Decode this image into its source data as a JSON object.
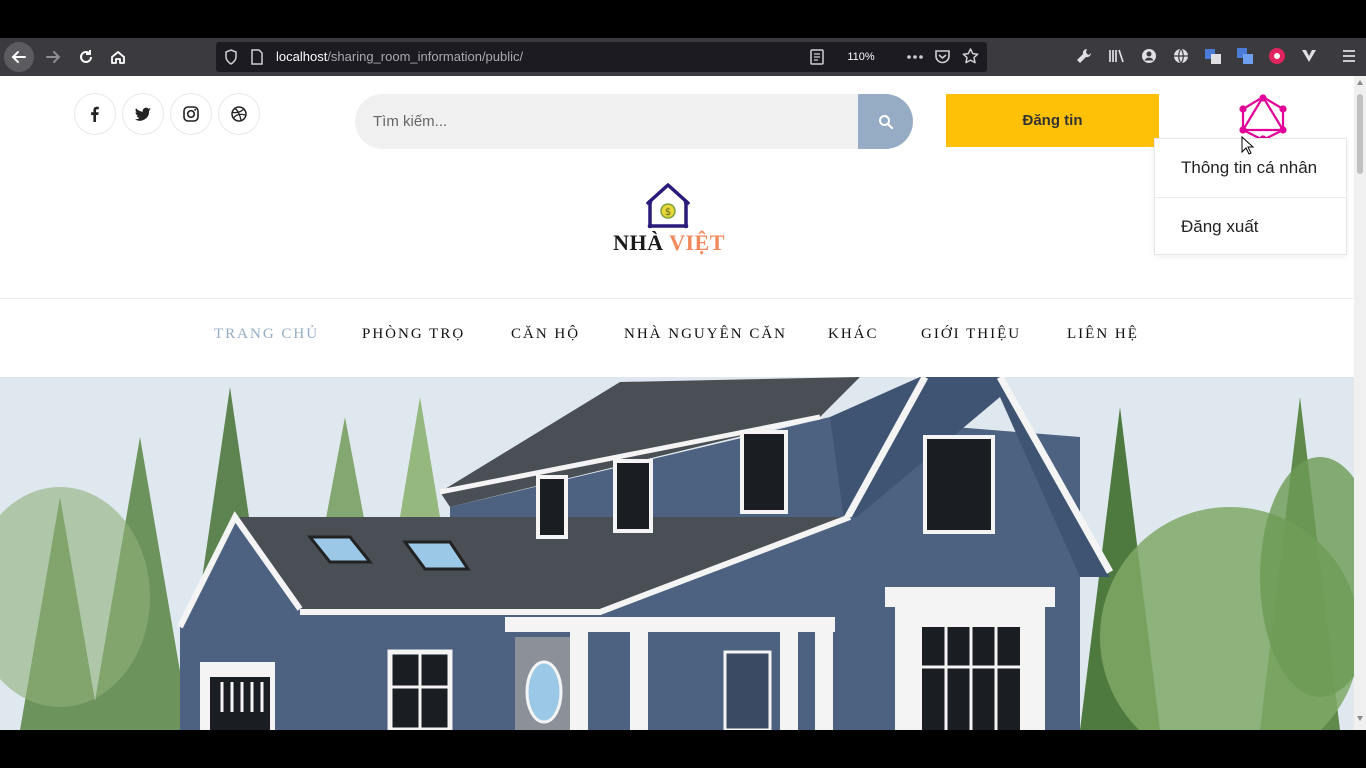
{
  "browser": {
    "url_host": "localhost",
    "url_path": "/sharing_room_information/public/",
    "zoom": "110%"
  },
  "header": {
    "social_icons": [
      "facebook-icon",
      "twitter-icon",
      "instagram-icon",
      "dribbble-icon"
    ],
    "search_placeholder": "Tìm kiếm...",
    "post_button": "Đăng tin",
    "accent_color": "#ffc107",
    "search_button_color": "#95acc4"
  },
  "user_menu": {
    "items": [
      "Thông tin cá nhân",
      "Đăng xuất"
    ]
  },
  "logo": {
    "word1": "NHÀ",
    "word2": "VIỆT"
  },
  "nav": {
    "items": [
      {
        "label": "TRANG CHỦ",
        "active": true
      },
      {
        "label": "PHÒNG TRỌ",
        "active": false
      },
      {
        "label": "CĂN HỘ",
        "active": false
      },
      {
        "label": "NHÀ NGUYÊN CĂN",
        "active": false
      },
      {
        "label": "KHÁC",
        "active": false
      },
      {
        "label": "GIỚI THIỆU",
        "active": false
      },
      {
        "label": "LIÊN HỆ",
        "active": false
      }
    ],
    "active_color": "#95acc4"
  }
}
